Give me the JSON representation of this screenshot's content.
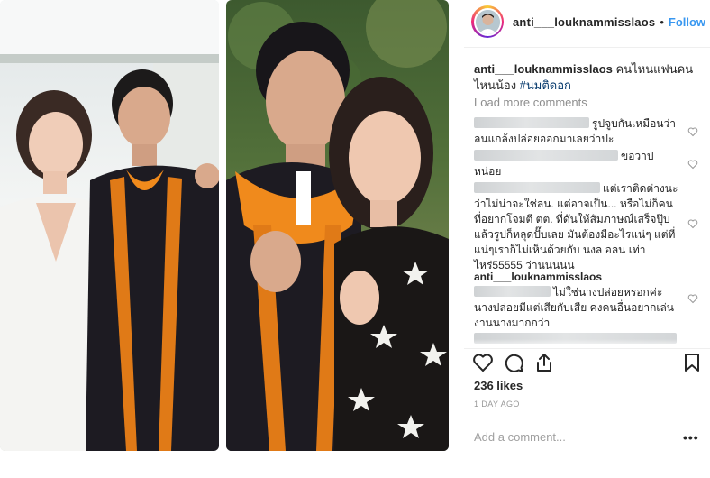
{
  "post": {
    "username": "anti___louknammisslaos",
    "separator": "•",
    "follow_label": "Follow",
    "caption_text": "คนไหนแฟนคนไหนน้อง",
    "caption_hashtag": "#นมติดอก",
    "load_more": "Load more comments",
    "likes": "236 likes",
    "date": "1 DAY AGO",
    "add_comment_placeholder": "Add a comment...",
    "more_label": "•••"
  },
  "comments": [
    {
      "text": "รูปจูบกันเหมือนว่าลนแกล้งปล่อยออกมาเลยว่าปะ"
    },
    {
      "text": "ขอวาปหน่อย"
    },
    {
      "text": "แต่เราติดต่างนะว่าไม่น่าจะใช่ลน. แต่อาจเป็น... หรือไม่ก็คนที่อยากโจมตี ตต. ที่ดันให้สัมภาษณ์เสร็จปุ๊บแล้วรูปก็หลุดปั๊บเลย มันต้องมีอะไรแน่ๆ แต่ที่แน่ๆเราก็ไม่เห็นด้วยกับ นงล อลน เท่าไหร่55555 ว่านนนนน"
    },
    {
      "user": "anti___louknammisslaos",
      "text": "ไม่ใช่นางปล่อยหรอกค่ะนางปล่อยมีแต่เสียกับเสีย คงคนอื่นอยากเล่นงานนางมากกว่า"
    }
  ],
  "icons": {
    "heart": "heart-icon",
    "comment": "comment-icon",
    "share": "share-icon",
    "save": "bookmark-icon"
  },
  "colors": {
    "follow": "#3897f0",
    "hashtag": "#003569",
    "muted": "#8e8e8e"
  }
}
